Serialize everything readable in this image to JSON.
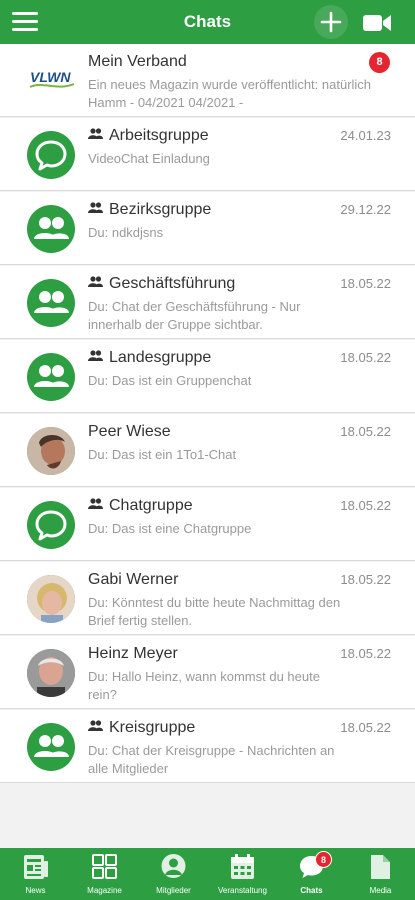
{
  "header": {
    "title": "Chats",
    "left_icon": "menu-icon",
    "right_icons": [
      "plus-icon",
      "video-camera-icon"
    ]
  },
  "colors": {
    "brand_green": "#2e9e43",
    "badge_red": "#e3262f",
    "preview_gray": "#9a9a9a"
  },
  "chats": [
    {
      "name": "Mein Verband",
      "group": false,
      "avatar": "vlwn-logo",
      "logo_text": "VLWN",
      "preview": "Ein neues Magazin wurde veröffentlicht: natürlich Hamm - 04/2021 04/2021 -",
      "date": "",
      "unread": "8"
    },
    {
      "name": "Arbeitsgruppe",
      "group": true,
      "avatar": "chat-bubble-icon",
      "preview": "VideoChat Einladung",
      "date": "24.01.23"
    },
    {
      "name": "Bezirksgruppe",
      "group": true,
      "avatar": "group-icon",
      "preview": "Du: ndkdjsns",
      "date": "29.12.22"
    },
    {
      "name": "Geschäftsführung",
      "group": true,
      "avatar": "group-icon",
      "preview": "Du: Chat der Geschäftsführung - Nur innerhalb der Gruppe sichtbar.",
      "date": "18.05.22"
    },
    {
      "name": "Landesgruppe",
      "group": true,
      "avatar": "group-icon",
      "preview": "Du: Das ist ein Gruppenchat",
      "date": "18.05.22"
    },
    {
      "name": "Peer Wiese",
      "group": false,
      "avatar": "photo-peer",
      "preview": "Du: Das ist ein 1To1-Chat",
      "date": "18.05.22"
    },
    {
      "name": "Chatgruppe",
      "group": true,
      "avatar": "chat-bubble-icon",
      "preview": "Du: Das ist eine Chatgruppe",
      "date": "18.05.22"
    },
    {
      "name": "Gabi Werner",
      "group": false,
      "avatar": "photo-gabi",
      "preview": "Du: Könntest du bitte heute Nachmittag den Brief fertig stellen.",
      "date": "18.05.22"
    },
    {
      "name": "Heinz Meyer",
      "group": false,
      "avatar": "photo-heinz",
      "preview": "Du: Hallo Heinz, wann kommst du heute rein?",
      "date": "18.05.22"
    },
    {
      "name": "Kreisgruppe",
      "group": true,
      "avatar": "group-icon",
      "preview": "Du: Chat der Kreisgruppe - Nachrichten an alle Mitglieder",
      "date": "18.05.22"
    }
  ],
  "bottom_nav": [
    {
      "label": "News",
      "icon": "news-icon"
    },
    {
      "label": "Magazine",
      "icon": "grid-icon"
    },
    {
      "label": "Mitglieder",
      "icon": "member-icon"
    },
    {
      "label": "Veranstaltung",
      "icon": "calendar-icon"
    },
    {
      "label": "Chats",
      "icon": "chat-icon",
      "badge": "8",
      "active": true
    },
    {
      "label": "Media",
      "icon": "document-icon"
    }
  ]
}
